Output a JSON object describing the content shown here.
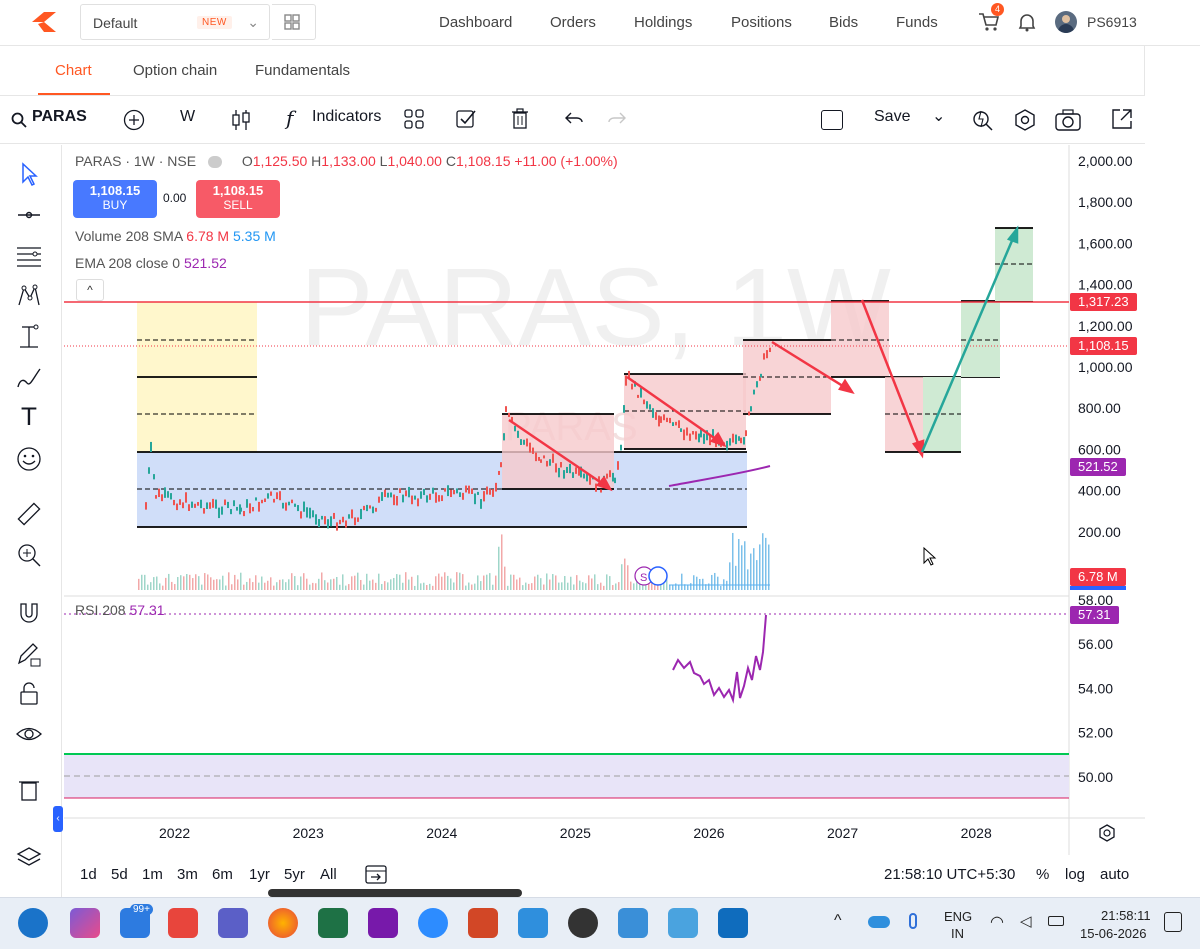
{
  "topbar": {
    "watchlist": "Default",
    "new_badge": "NEW",
    "nav": [
      "Dashboard",
      "Orders",
      "Holdings",
      "Positions",
      "Bids",
      "Funds"
    ],
    "cart_count": "4",
    "user": "PS6913"
  },
  "subtabs": [
    "Chart",
    "Option chain",
    "Fundamentals"
  ],
  "toolbar": {
    "symbol": "PARAS",
    "interval": "W",
    "indicators": "Indicators",
    "save": "Save"
  },
  "legend": {
    "symbol_line": "PARAS · 1W · NSE",
    "o_label": "O",
    "open": "1,125.50",
    "h_label": "H",
    "high": "1,133.00",
    "l_label": "L",
    "low": "1,040.00",
    "c_label": "C",
    "close": "1,108.15",
    "change": "+11.00 (+1.00%)",
    "buy_price": "1,108.15",
    "buy_label": "BUY",
    "spread": "0.00",
    "sell_price": "1,108.15",
    "sell_label": "SELL",
    "volume_label": "Volume 208 SMA",
    "volume_val1": "6.78 M",
    "volume_val2": "5.35 M",
    "ema_label": "EMA 208 close 0",
    "ema_val": "521.52",
    "rsi_label": "RSI 208",
    "rsi_val": "57.31",
    "watermark": "PARAS, 1W",
    "watermark_small": "PARAS",
    "collapse": "^"
  },
  "price_axis": [
    "2,000.00",
    "1,800.00",
    "1,600.00",
    "1,400.00",
    "1,200.00",
    "1,000.00",
    "800.00",
    "600.00",
    "400.00",
    "200.00"
  ],
  "price_tags": {
    "level": "1,317.23",
    "last": "1,108.15",
    "ema": "521.52",
    "volume": "6.78 M",
    "rsi": "57.31"
  },
  "rsi_axis": [
    "58.00",
    "56.00",
    "54.00",
    "52.00",
    "50.00"
  ],
  "time_axis": [
    "2022",
    "2023",
    "2024",
    "2025",
    "2026",
    "2027",
    "2028"
  ],
  "bottombar": {
    "ranges": [
      "1d",
      "5d",
      "1m",
      "3m",
      "6m",
      "1yr",
      "5yr",
      "All"
    ],
    "clock": "21:58:10 UTC+5:30",
    "percent": "%",
    "log": "log",
    "auto": "auto"
  },
  "taskbar": {
    "badge": "99+",
    "lang1": "ENG",
    "lang2": "IN",
    "time": "21:58:11",
    "date": "15-06-2026"
  },
  "colors": {
    "brand": "#ff5722",
    "buy": "#2962ff",
    "sell": "#f7525f",
    "resistance": "#f23645",
    "ema": "#9c27b0",
    "green": "#26a69a"
  },
  "icons": [
    "arrow-cursor-icon",
    "crosshair-icon",
    "trend-lines-icon",
    "pattern-icon",
    "measure-icon",
    "brush-icon",
    "text-icon",
    "emoji-icon",
    "ruler-icon",
    "zoom-in-icon",
    "magnet-icon",
    "lock-draw-icon",
    "lock-icon",
    "eye-icon",
    "trash-icon",
    "layers-icon"
  ]
}
